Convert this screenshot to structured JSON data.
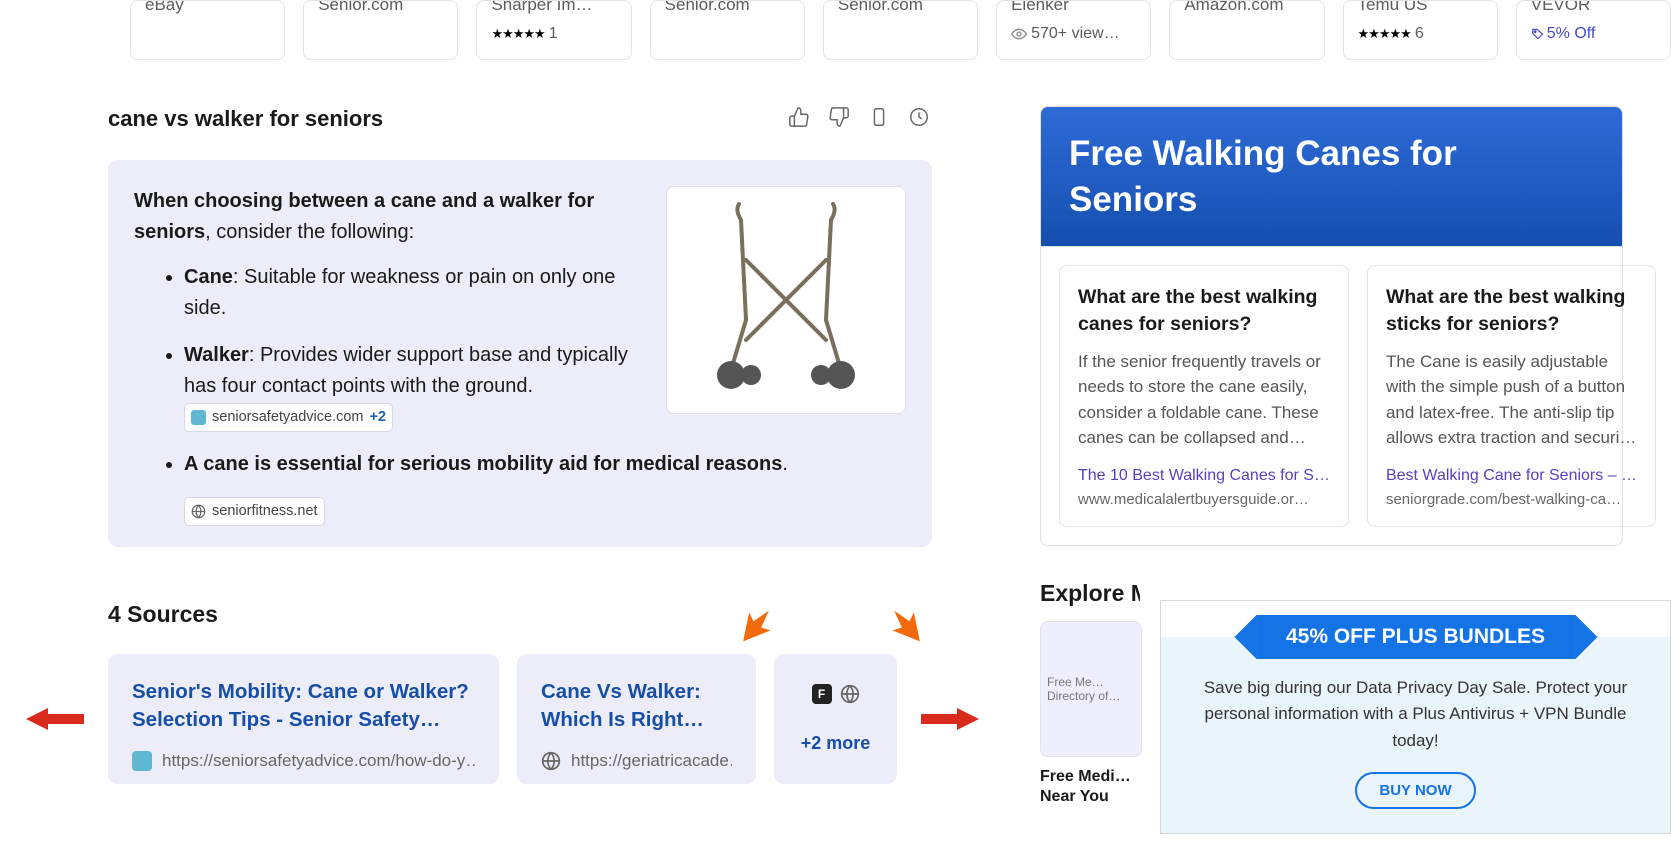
{
  "products": [
    {
      "name": "eBay",
      "meta_type": "none"
    },
    {
      "name": "Senior.com",
      "meta_type": "none"
    },
    {
      "name": "Sharper Im…",
      "meta_type": "stars",
      "stars": "★★★★★",
      "count": "1"
    },
    {
      "name": "Senior.com",
      "meta_type": "none"
    },
    {
      "name": "Senior.com",
      "meta_type": "none"
    },
    {
      "name": "Elenker",
      "meta_type": "views",
      "views": "570+ view…"
    },
    {
      "name": "Amazon.com",
      "meta_type": "none"
    },
    {
      "name": "Temu US",
      "meta_type": "stars",
      "stars": "★★★★★",
      "count": "6"
    },
    {
      "name": "VEVOR",
      "meta_type": "discount",
      "discount": "5% Off"
    }
  ],
  "query": "cane vs walker for seniors",
  "answer": {
    "intro_bold": "When choosing between a cane and a walker for seniors",
    "intro_rest": ", consider the following:",
    "bullets": [
      {
        "lead": "Cane",
        "rest": ": Suitable for weakness or pain on only one side."
      },
      {
        "lead": "Walker",
        "rest": ": Provides wider support base and typically has four contact points with the ground.",
        "chip": {
          "site": "seniorsafetyadvice.com",
          "plus": "+2",
          "icon": "blue"
        }
      },
      {
        "lead": "A cane is essential for serious mobility aid for medical reasons",
        "rest": ".",
        "chip_below": {
          "site": "seniorfitness.net",
          "icon": "globe"
        }
      }
    ]
  },
  "sources_heading": "4 Sources",
  "sources": [
    {
      "title": "Senior's Mobility: Cane or Walker? Selection Tips - Senior Safety…",
      "url": "https://seniorsafetyadvice.com/how-do-y…",
      "icon": "blue"
    },
    {
      "title": "Cane Vs Walker: Which Is Right For…",
      "url": "https://geriatricacade…",
      "icon": "globe"
    }
  ],
  "more_label": "+2 more",
  "right": {
    "banner": "Free Walking Canes for Seniors",
    "cards": [
      {
        "q": "What are the best walking canes for seniors?",
        "a": "If the senior frequently travels or needs to store the cane easily, consider a foldable cane. These canes can be collapsed and stored in a ba…",
        "link": "The 10 Best Walking Canes for S…",
        "dom": "www.medicalalertbuyersguide.or…"
      },
      {
        "q": "What are the best walking sticks for seniors?",
        "a": "The Cane is easily adjustable with the simple push of a button and latex-free. The anti-slip tip allows extra traction and security. There is also a…",
        "link": "Best Walking Cane for Seniors – …",
        "dom": "seniorgrade.com/best-walking-ca…"
      }
    ],
    "explore_heading": "Explore More",
    "explore": [
      {
        "thumb": "Free Me… Directory of…",
        "label": "Free Medi… Near You"
      }
    ]
  },
  "promo": {
    "ribbon": "45% OFF PLUS BUNDLES",
    "text": "Save big during our Data Privacy Day Sale. Protect your personal information with a Plus Antivirus + VPN Bundle today!",
    "btn": "BUY NOW"
  }
}
